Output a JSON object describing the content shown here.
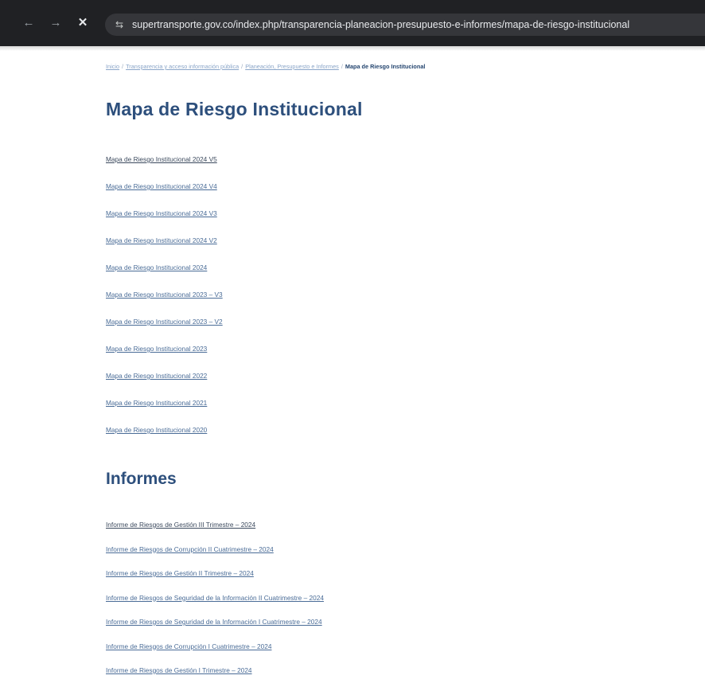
{
  "browser": {
    "back_icon": "arrow-left-icon",
    "forward_icon": "arrow-right-icon",
    "stop_icon": "close-icon",
    "site_info_icon": "tune-icon",
    "url": "supertransporte.gov.co/index.php/transparencia-planeacion-presupuesto-e-informes/mapa-de-riesgo-institucional"
  },
  "breadcrumb": {
    "items": [
      "Inicio",
      "Transparencia y acceso información pública",
      "Planeación, Presupuesto e Informes"
    ],
    "separator": "/",
    "current": "Mapa de Riesgo Institucional"
  },
  "section1": {
    "title": "Mapa de Riesgo Institucional",
    "links": [
      "Mapa de Riesgo Institucional 2024 V5",
      "Mapa de Riesgo Institucional 2024 V4",
      "Mapa de Riesgo Institucional 2024 V3",
      "Mapa de Riesgo Institucional 2024 V2",
      "Mapa de Riesgo Institucional 2024",
      "Mapa de Riesgo Institucional 2023 – V3",
      "Mapa de Riesgo Institucional 2023 – V2",
      "Mapa de Riesgo Institucional 2023",
      "Mapa de Riesgo Institucional 2022",
      "Mapa de Riesgo Institucional 2021",
      "Mapa de Riesgo Institucional 2020"
    ]
  },
  "section2": {
    "title": "Informes",
    "links": [
      "Informe de Riesgos de Gestión III Trimestre – 2024",
      "Informe de Riesgos de Corrupción II Cuatrimestre – 2024",
      "Informe de Riesgos de Gestión II Trimestre – 2024",
      "Informe de Riesgos de Seguridad de la Información II Cuatrimestre – 2024",
      "Informe de Riesgos de Seguridad de la Información I Cuatrimestre – 2024",
      "Informe de Riesgos de Corrupción I Cuatrimestre – 2024",
      "Informe de Riesgos de Gestión I Trimestre – 2024"
    ]
  }
}
